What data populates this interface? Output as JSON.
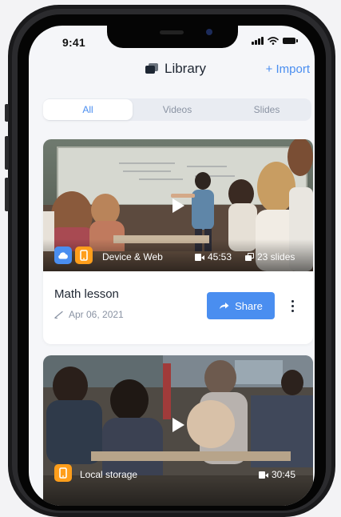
{
  "status_bar": {
    "time": "9:41"
  },
  "header": {
    "title": "Library",
    "import_label": "+ Import"
  },
  "tabs": [
    {
      "label": "All",
      "active": true
    },
    {
      "label": "Videos",
      "active": false
    },
    {
      "label": "Slides",
      "active": false
    }
  ],
  "items": [
    {
      "title": "Math lesson",
      "date": "Apr 06, 2021",
      "source": "Device & Web",
      "duration": "45:53",
      "slides": "23 slides",
      "share_label": "Share"
    },
    {
      "source": "Local storage",
      "duration": "30:45"
    }
  ],
  "colors": {
    "accent": "#4a8ef0",
    "cloud_badge": "#4a8ef0",
    "device_badge": "#ff9e1b",
    "text_primary": "#1f2733",
    "text_secondary": "#8a93a3"
  },
  "icons": {
    "library": "library-icon",
    "cloud": "cloud-icon",
    "device": "phone-icon",
    "video": "video-camera-icon",
    "slides": "slides-icon",
    "date": "pen-icon",
    "share": "share-arrow-icon",
    "more": "more-vertical-icon",
    "play": "play-icon"
  }
}
